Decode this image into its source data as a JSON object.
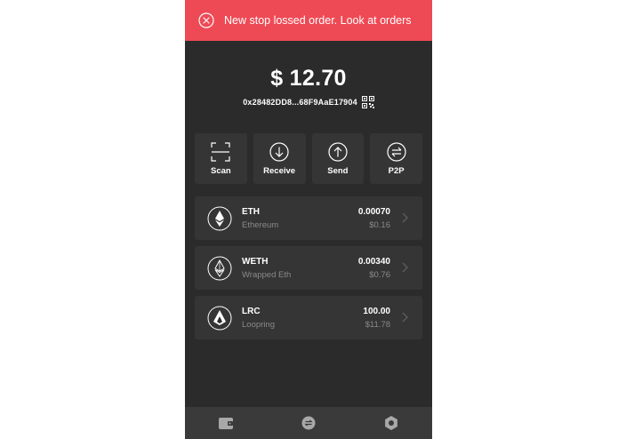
{
  "banner": {
    "message": "New stop lossed order. Look at orders",
    "icon": "close-circle-icon",
    "color": "#ee4a55"
  },
  "wallet": {
    "balance": "$ 12.70",
    "address": "0x28482DD8...68F9AaE17904",
    "qr_icon": "qr-code-icon"
  },
  "actions": [
    {
      "label": "Scan",
      "icon": "scan-icon"
    },
    {
      "label": "Receive",
      "icon": "receive-icon"
    },
    {
      "label": "Send",
      "icon": "send-icon"
    },
    {
      "label": "P2P",
      "icon": "swap-icon"
    }
  ],
  "tokens": [
    {
      "symbol": "ETH",
      "name": "Ethereum",
      "amount": "0.00070",
      "fiat": "$0.16",
      "icon": "ethereum-icon"
    },
    {
      "symbol": "WETH",
      "name": "Wrapped Eth",
      "amount": "0.00340",
      "fiat": "$0.76",
      "icon": "ethereum-icon"
    },
    {
      "symbol": "LRC",
      "name": "Loopring",
      "amount": "100.00",
      "fiat": "$11.78",
      "icon": "loopring-icon"
    }
  ],
  "tabbar": [
    {
      "icon": "wallet-icon"
    },
    {
      "icon": "exchange-icon"
    },
    {
      "icon": "settings-icon"
    }
  ],
  "colors": {
    "background": "#2b2b2b",
    "card": "#353535",
    "tabbar": "#3a3a3a",
    "muted_text": "#8a8a8a"
  }
}
